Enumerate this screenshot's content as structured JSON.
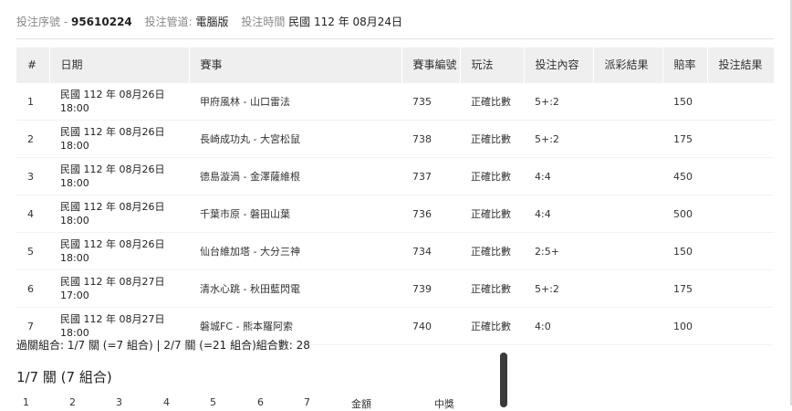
{
  "header": {
    "serial_label": "投注序號 -",
    "serial_value": "95610224",
    "channel_label": "投注管道:",
    "channel_value": "電腦版",
    "time_label": "投注時間",
    "time_value": "民國 112 年 08月24日"
  },
  "table": {
    "columns": [
      "#",
      "日期",
      "賽事",
      "賽事編號",
      "玩法",
      "投注內容",
      "派彩結果",
      "賠率",
      "投注結果"
    ],
    "rows": [
      {
        "no": "1",
        "date": "民國 112 年 08月26日",
        "time": "18:00",
        "match": "甲府風林 - 山口雷法",
        "match_no": "735",
        "play": "正確比數",
        "content": "5+:2",
        "payout": "",
        "odds": "150",
        "result": ""
      },
      {
        "no": "2",
        "date": "民國 112 年 08月26日",
        "time": "18:00",
        "match": "長崎成功丸 - 大宮松鼠",
        "match_no": "738",
        "play": "正確比數",
        "content": "5+:2",
        "payout": "",
        "odds": "175",
        "result": ""
      },
      {
        "no": "3",
        "date": "民國 112 年 08月26日",
        "time": "18:00",
        "match": "德島漩渦 - 金澤薩維根",
        "match_no": "737",
        "play": "正確比數",
        "content": "4:4",
        "payout": "",
        "odds": "450",
        "result": ""
      },
      {
        "no": "4",
        "date": "民國 112 年 08月26日",
        "time": "18:00",
        "match": "千葉市原 - 磐田山葉",
        "match_no": "736",
        "play": "正確比數",
        "content": "4:4",
        "payout": "",
        "odds": "500",
        "result": ""
      },
      {
        "no": "5",
        "date": "民國 112 年 08月26日",
        "time": "18:00",
        "match": "仙台維加塔 - 大分三神",
        "match_no": "734",
        "play": "正確比數",
        "content": "2:5+",
        "payout": "",
        "odds": "150",
        "result": ""
      },
      {
        "no": "6",
        "date": "民國 112 年 08月27日",
        "time": "17:00",
        "match": "清水心跳 - 秋田藍閃電",
        "match_no": "739",
        "play": "正確比數",
        "content": "5+:2",
        "payout": "",
        "odds": "175",
        "result": ""
      },
      {
        "no": "7",
        "date": "民國 112 年 08月27日",
        "time": "18:00",
        "match": "磐城FC - 熊本羅阿索",
        "match_no": "740",
        "play": "正確比數",
        "content": "4:0",
        "payout": "",
        "odds": "100",
        "result": ""
      }
    ]
  },
  "summary": "過關組合: 1/7 關 (=7 組合) | 2/7 關 (=21 組合)組合數: 28",
  "section_title": "1/7 關 (7 組合)",
  "sub_columns": [
    "1",
    "2",
    "3",
    "4",
    "5",
    "6",
    "7",
    "金額",
    "中獎"
  ]
}
